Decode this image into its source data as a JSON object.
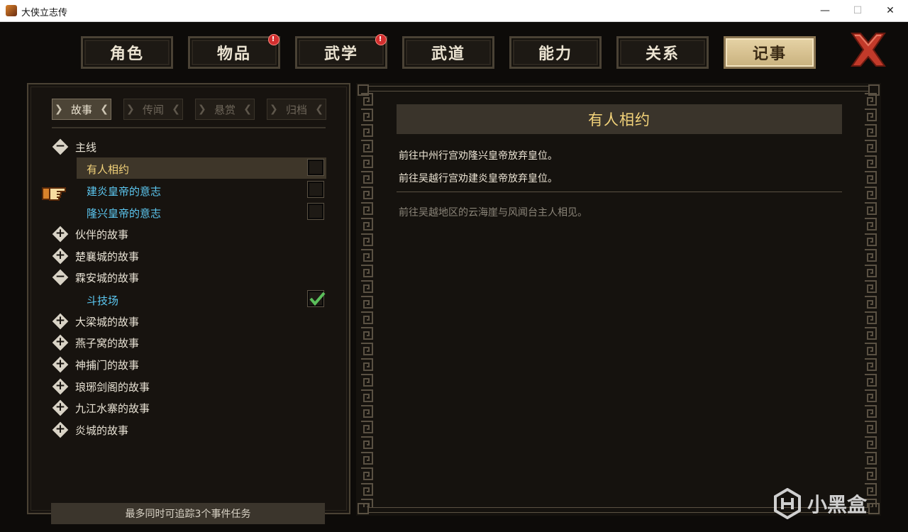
{
  "window": {
    "title": "大侠立志传",
    "minimize_symbol": "—",
    "maximize_symbol": "☐",
    "close_symbol": "✕"
  },
  "tabs": [
    {
      "label": "角色",
      "alert": false
    },
    {
      "label": "物品",
      "alert": true
    },
    {
      "label": "武学",
      "alert": true
    },
    {
      "label": "武道",
      "alert": false
    },
    {
      "label": "能力",
      "alert": false
    },
    {
      "label": "关系",
      "alert": false
    },
    {
      "label": "记事",
      "alert": false,
      "active": true
    }
  ],
  "alert_symbol": "!",
  "subtabs": [
    "故事",
    "传闻",
    "悬赏",
    "归档"
  ],
  "subtab_active": "故事",
  "tree": {
    "mainline": {
      "label": "主线",
      "expanded": true
    },
    "mainline_quests": [
      {
        "label": "有人相约",
        "selected": true,
        "checked": false
      },
      {
        "label": "建炎皇帝的意志",
        "checked": false
      },
      {
        "label": "隆兴皇帝的意志",
        "checked": false
      }
    ],
    "groups": [
      {
        "label": "伙伴的故事",
        "expanded": false
      },
      {
        "label": "楚襄城的故事",
        "expanded": false
      },
      {
        "label": "霖安城的故事",
        "expanded": true
      },
      {
        "label": "大梁城的故事",
        "expanded": false
      },
      {
        "label": "燕子窝的故事",
        "expanded": false
      },
      {
        "label": "神捕门的故事",
        "expanded": false
      },
      {
        "label": "琅琊剑阁的故事",
        "expanded": false
      },
      {
        "label": "九江水寨的故事",
        "expanded": false
      },
      {
        "label": "炎城的故事",
        "expanded": false
      }
    ],
    "linan_quests": [
      {
        "label": "斗技场",
        "checked": true
      }
    ]
  },
  "footer_note": "最多同时可追踪3个事件任务",
  "quest_detail": {
    "title": "有人相约",
    "objectives": [
      "前往中州行宫劝隆兴皇帝放弃皇位。",
      "前往吴越行宫劝建炎皇帝放弃皇位。"
    ],
    "description": "前往吴越地区的云海崖与风闻台主人相见。"
  },
  "watermark": "小黑盒",
  "colors": {
    "accent_gold": "#f3d37a",
    "quest_blue": "#5cc8f2",
    "alert_red": "#d32f2f",
    "check_green": "#5bbf5b"
  },
  "icons": [
    "app-icon",
    "minimize-icon",
    "maximize-icon",
    "close-window-icon",
    "close-x-icon",
    "pointing-hand-icon",
    "minus-icon",
    "plus-icon",
    "checkmark-icon",
    "xiaoheihe-logo-icon"
  ]
}
